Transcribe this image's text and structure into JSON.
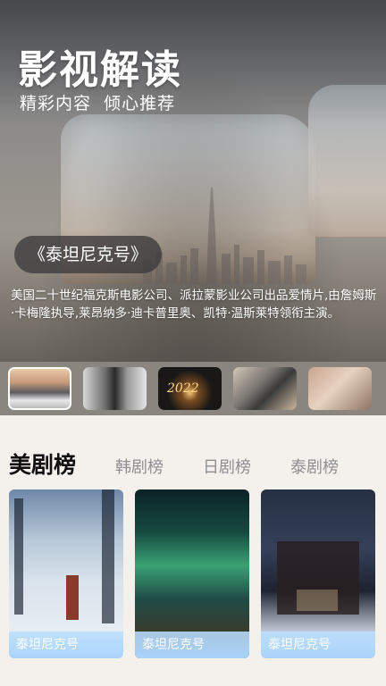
{
  "hero": {
    "title": "影视解读",
    "subtitle": "精彩内容  倾心推荐",
    "movie_title": "《泰坦尼克号》",
    "description": "美国二十世纪福克斯电影公司、派拉蒙影业公司出品爱情片,由詹姆斯·卡梅隆执导,莱昂纳多·迪卡普里奥、凯特·温斯莱特领衔主演。"
  },
  "thumbnails": [
    {
      "name": "fog-mountain",
      "selected": true
    },
    {
      "name": "couple-bw",
      "selected": false
    },
    {
      "name": "sparkler-2022",
      "selected": false,
      "text": "2022"
    },
    {
      "name": "laptop",
      "selected": false
    },
    {
      "name": "hands-ring",
      "selected": false
    }
  ],
  "ranking": {
    "tabs": [
      "美剧榜",
      "韩剧榜",
      "日剧榜",
      "泰剧榜"
    ],
    "active_tab": 0,
    "cards": [
      {
        "caption": "泰坦尼克号",
        "image": "snow-forest-reindeer"
      },
      {
        "caption": "泰坦尼克号",
        "image": "northern-lights"
      },
      {
        "caption": "泰坦尼克号",
        "image": "snowy-house-night"
      }
    ]
  },
  "colors": {
    "caption_bar": "#a9d3fb",
    "tab_active": "#111111",
    "tab_inactive": "#8f8f8f",
    "strip_bg": "#8b8580"
  }
}
